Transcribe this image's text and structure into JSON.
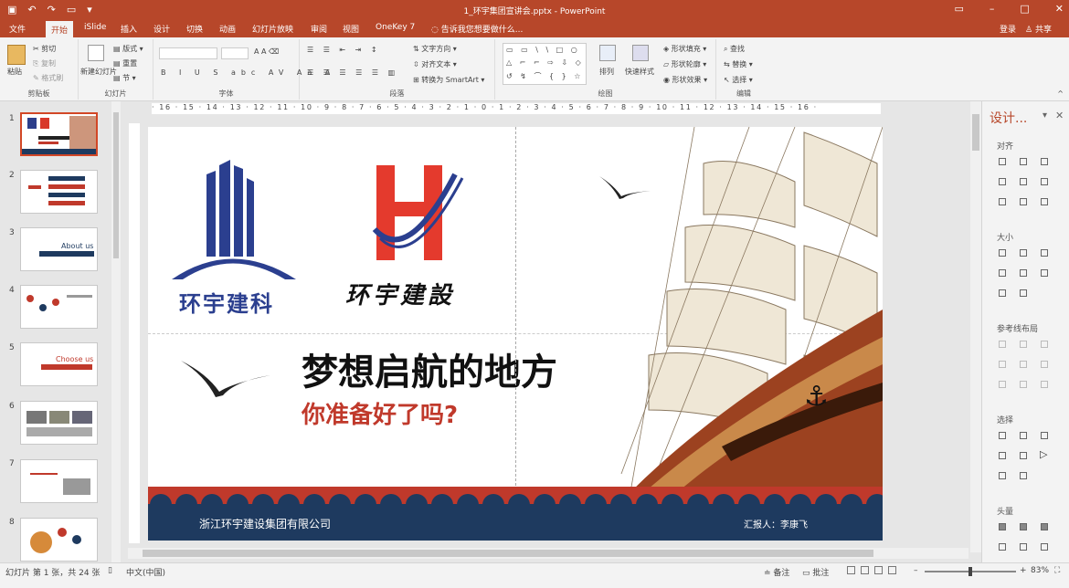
{
  "window": {
    "title": "1_环宇集团宣讲会.pptx - PowerPoint"
  },
  "tabs": [
    "文件",
    "开始",
    "iSlide",
    "插入",
    "设计",
    "切换",
    "动画",
    "幻灯片放映",
    "审阅",
    "视图",
    "OneKey 7"
  ],
  "tell_me": "告诉我您想要做什么...",
  "account": {
    "login": "登录",
    "share": "共享"
  },
  "clipboard": {
    "paste": "粘贴",
    "cut": "剪切",
    "copy": "复制",
    "format_painter": "格式刷",
    "label": "剪贴板"
  },
  "slides_group": {
    "new_slide": "新建幻灯片",
    "layout": "版式",
    "reset": "重置",
    "section": "节",
    "label": "幻灯片"
  },
  "font_group": {
    "label": "字体"
  },
  "paragraph_group": {
    "label": "段落",
    "text_direction": "文字方向",
    "align_text": "对齐文本",
    "smartart": "转换为 SmartArt"
  },
  "drawing_group": {
    "label": "绘图",
    "arrange": "排列",
    "quick_styles": "快速样式",
    "shape_fill": "形状填充",
    "shape_outline": "形状轮廓",
    "shape_effects": "形状效果"
  },
  "editing_group": {
    "label": "编辑",
    "find": "查找",
    "replace": "替换",
    "select": "选择"
  },
  "ruler": {
    "h": "· 16 · 15 · 14 · 13 · 12 · 11 · 10 · 9 · 8 · 7 · 6 · 5 · 4 · 3 · 2 · 1 · 0 · 1 · 2 · 3 · 4 · 5 · 6 · 7 · 8 · 9 · 10 · 11 · 12 · 13 · 14 · 15 · 16 ·"
  },
  "slide": {
    "logo1_text": "环宇建科",
    "logo2_text": "环宇建設",
    "headline": "梦想启航的地方",
    "subheadline": "你准备好了吗?",
    "footer_company": "浙江环宇建设集团有限公司",
    "footer_reporter": "汇报人：李康飞"
  },
  "thumbnails": [
    {
      "num": "1"
    },
    {
      "num": "2"
    },
    {
      "num": "3",
      "text": "About us"
    },
    {
      "num": "4"
    },
    {
      "num": "5",
      "text": "Choose us"
    },
    {
      "num": "6"
    },
    {
      "num": "7"
    },
    {
      "num": "8"
    }
  ],
  "design_pane": {
    "title": "设计...",
    "align": "对齐",
    "size": "大小",
    "guides": "参考线布局",
    "select": "选择",
    "layer": "头量"
  },
  "status": {
    "slide_info": "幻灯片 第 1 张，共 24 张",
    "language": "中文(中国)",
    "notes": "备注",
    "comments": "批注",
    "zoom": "83%"
  },
  "colors": {
    "accent": "#b7472a",
    "navy": "#1e3a5f",
    "red": "#c0392b"
  }
}
